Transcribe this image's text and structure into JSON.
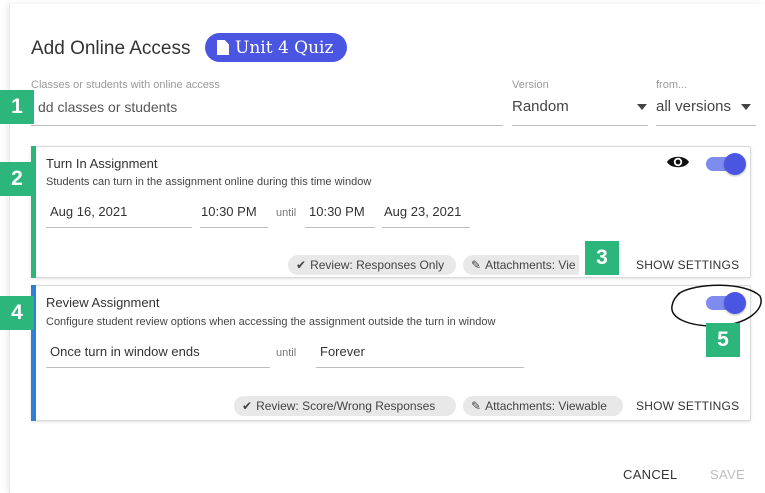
{
  "dialog": {
    "title": "Add Online Access",
    "assignment_pill": "Unit 4 Quiz",
    "access_label": "Classes or students with online access",
    "access_placeholder": "dd classes or students",
    "version_label": "Version",
    "version_value": "Random",
    "from_label": "from...",
    "from_value": "all versions"
  },
  "turn_in": {
    "title": "Turn In Assignment",
    "description": "Students can turn in the assignment online during this time window",
    "start_date": "Aug 16, 2021",
    "start_time": "10:30 PM",
    "until": "until",
    "end_time": "10:30 PM",
    "end_date": "Aug 23, 2021",
    "chip_review": "Review: Responses Only",
    "chip_attachments": "Attachments: Vie",
    "show_settings": "SHOW SETTINGS",
    "toggle_on": true,
    "accent": "#2db67c"
  },
  "review": {
    "title": "Review Assignment",
    "description": "Configure student review options when accessing the assignment outside the turn in window",
    "start": "Once turn in window ends",
    "until": "until",
    "end": "Forever",
    "chip_review": "Review: Score/Wrong Responses",
    "chip_attachments": "Attachments: Viewable",
    "show_settings": "SHOW SETTINGS",
    "toggle_on": true,
    "accent": "#2f7ed8"
  },
  "footer": {
    "cancel": "CANCEL",
    "save": "SAVE"
  },
  "badges": [
    "1",
    "2",
    "3",
    "4",
    "5"
  ],
  "colors": {
    "primary": "#4a56e2",
    "badge": "#2db67c"
  }
}
